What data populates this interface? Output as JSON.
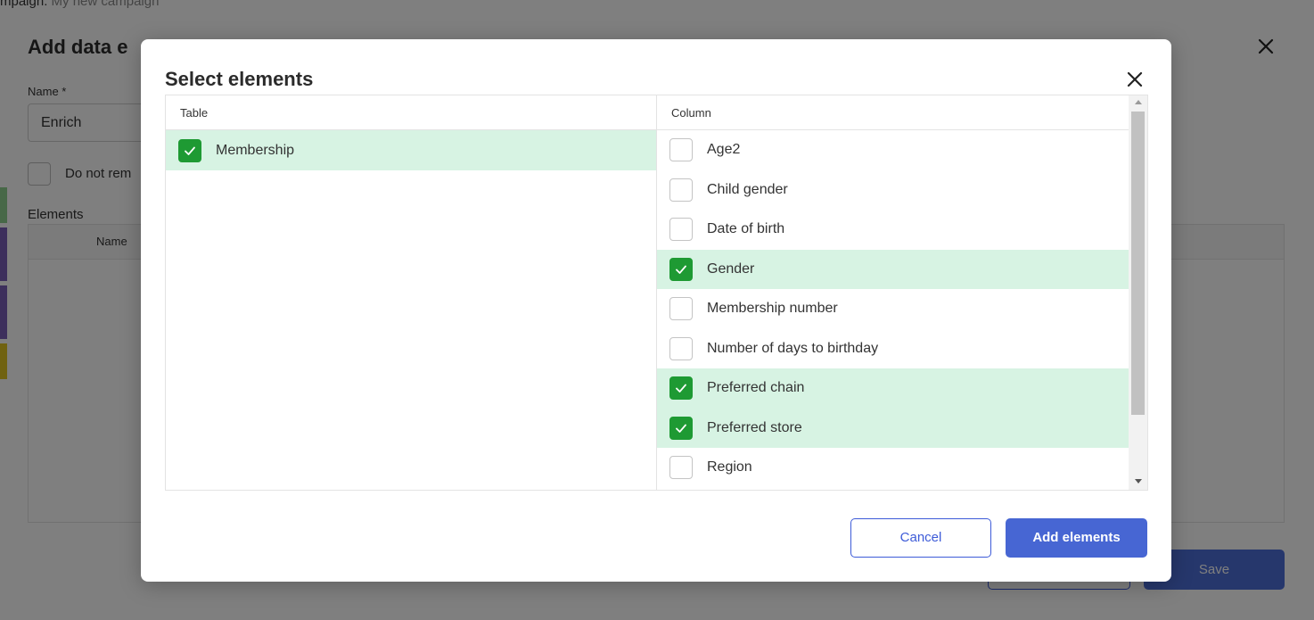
{
  "background": {
    "breadcrumb_prefix": "mpaign:",
    "breadcrumb_value": "My new campaign",
    "dialog_title": "Add data e",
    "name_label": "Name *",
    "name_value": "Enrich",
    "checkbox_label": "Do not rem",
    "elements_label": "Elements",
    "grid_col_name": "Name",
    "save_label": "Save"
  },
  "modal": {
    "title": "Select elements",
    "table_header": "Table",
    "column_header": "Column",
    "tables": [
      {
        "label": "Membership",
        "checked": true
      }
    ],
    "columns": [
      {
        "label": "Age2",
        "checked": false
      },
      {
        "label": "Child gender",
        "checked": false
      },
      {
        "label": "Date of birth",
        "checked": false
      },
      {
        "label": "Gender",
        "checked": true
      },
      {
        "label": "Membership number",
        "checked": false
      },
      {
        "label": "Number of days to birthday",
        "checked": false
      },
      {
        "label": "Preferred chain",
        "checked": true
      },
      {
        "label": "Preferred store",
        "checked": true
      },
      {
        "label": "Region",
        "checked": false
      }
    ],
    "cancel_label": "Cancel",
    "add_label": "Add elements"
  },
  "colors": {
    "accent": "#4766d3",
    "check_green": "#1e9a33",
    "selected_row": "#d7f3e3"
  }
}
